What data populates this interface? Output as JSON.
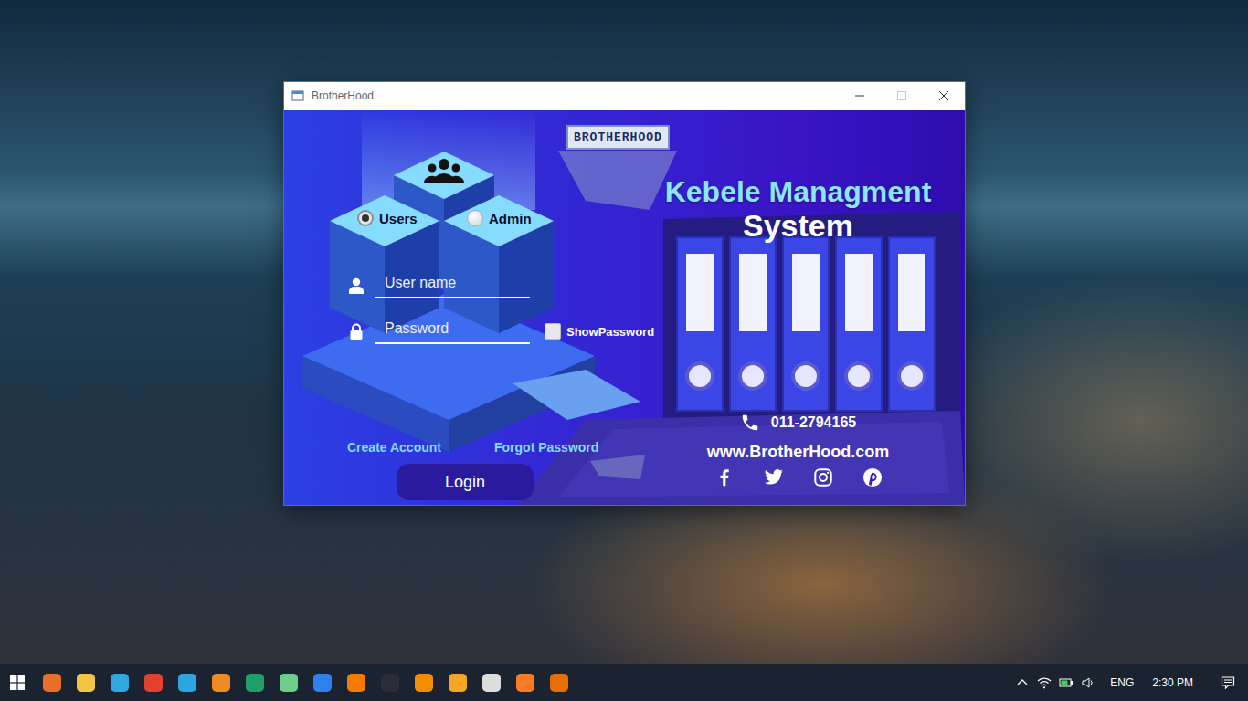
{
  "window": {
    "title": "BrotherHood",
    "maximize_disabled": true
  },
  "app": {
    "logo": "BROTHERHOOD",
    "title": "Kebele Managment",
    "subtitle": "System",
    "roles": [
      {
        "label": "Users",
        "selected": true
      },
      {
        "label": "Admin",
        "selected": false
      }
    ],
    "fields": [
      {
        "kind": "text",
        "placeholder": "User name"
      },
      {
        "kind": "password",
        "placeholder": "Password"
      }
    ],
    "show_password": {
      "label": "ShowPassword",
      "checked": false
    },
    "links": [
      "Create Account",
      "Forgot Password"
    ],
    "login_button": "Login",
    "phone": "011-2794165",
    "website": "www.BrotherHood.com",
    "socials": [
      {
        "kind": "facebook"
      },
      {
        "kind": "twitter"
      },
      {
        "kind": "instagram"
      },
      {
        "kind": "pinterest"
      }
    ]
  },
  "taskbar": {
    "apps": [
      {
        "color": "#e8702a"
      },
      {
        "color": "#f4c542"
      },
      {
        "color": "#2fa8e0"
      },
      {
        "color": "#e3412f"
      },
      {
        "color": "#2ca5e0"
      },
      {
        "color": "#f08a24"
      },
      {
        "color": "#1fa06a"
      },
      {
        "color": "#6dcf8b"
      },
      {
        "color": "#2f80ed"
      },
      {
        "color": "#f57c00"
      },
      {
        "color": "#2b2b3a"
      },
      {
        "color": "#f28c00"
      },
      {
        "color": "#f5a623"
      },
      {
        "color": "#dddddd"
      },
      {
        "color": "#fb7a24"
      },
      {
        "color": "#e76f00"
      }
    ],
    "language": "ENG",
    "time": "2:30 PM"
  }
}
